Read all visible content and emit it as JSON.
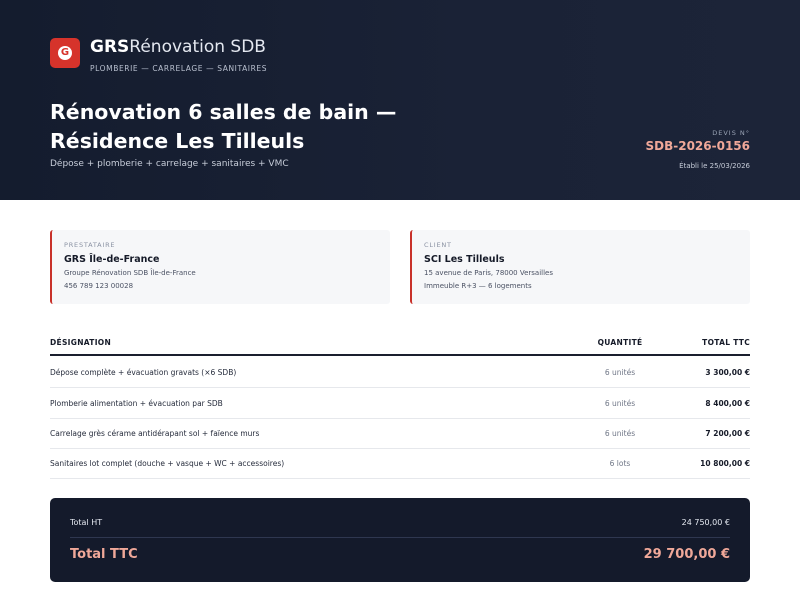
{
  "header": {
    "logo_letter": "G",
    "brand_bold": "GRS",
    "brand_light": "Rénovation SDB",
    "tagline": "PLOMBERIE — CARRELAGE — SANITAIRES",
    "title": "Rénovation 6 salles de bain — Résidence Les Tilleuls",
    "subtitle": "Dépose + plomberie + carrelage + sanitaires + VMC",
    "quote_label": "DEVIS N°",
    "quote_number": "SDB-2026-0156",
    "quote_date": "Établi le 25/03/2026"
  },
  "provider": {
    "label": "PRESTATAIRE",
    "name": "GRS Île-de-France",
    "line1": "Groupe Rénovation SDB Île-de-France",
    "line2": "456 789 123 00028"
  },
  "client": {
    "label": "CLIENT",
    "name": "SCI Les Tilleuls",
    "line1": "15 avenue de Paris, 78000 Versailles",
    "line2": "Immeuble R+3 — 6 logements"
  },
  "table": {
    "headers": {
      "designation": "DÉSIGNATION",
      "quantity": "QUANTITÉ",
      "total": "TOTAL TTC"
    },
    "rows": [
      {
        "designation": "Dépose complète + évacuation gravats (×6 SDB)",
        "quantity": "6 unités",
        "total": "3 300,00 €"
      },
      {
        "designation": "Plomberie alimentation + évacuation par SDB",
        "quantity": "6 unités",
        "total": "8 400,00 €"
      },
      {
        "designation": "Carrelage grès cérame antidérapant sol + faïence murs",
        "quantity": "6 unités",
        "total": "7 200,00 €"
      },
      {
        "designation": "Sanitaires lot complet (douche + vasque + WC + accessoires)",
        "quantity": "6 lots",
        "total": "10 800,00 €"
      }
    ]
  },
  "totals": {
    "ht_label": "Total HT",
    "ht_value": "24 750,00 €",
    "ttc_label": "Total TTC",
    "ttc_value": "29 700,00 €"
  },
  "colors": {
    "hero_bg": "#141c2e",
    "accent_red": "#d6332b",
    "accent_salmon": "#f0a899",
    "totals_bg": "#141a2b"
  }
}
